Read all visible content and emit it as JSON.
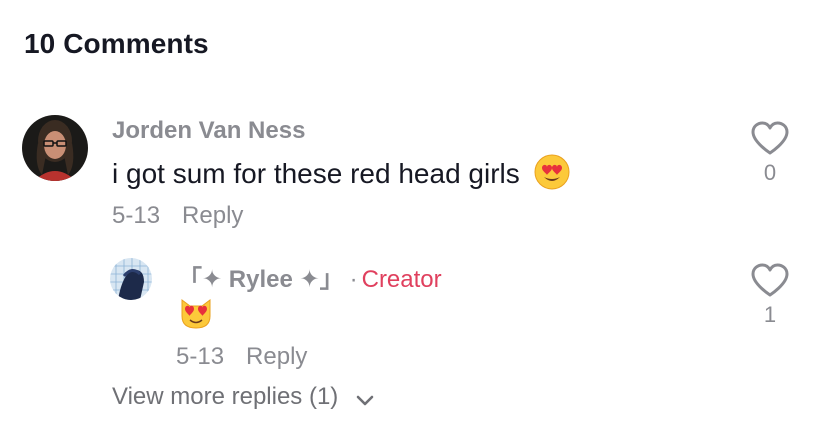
{
  "header": {
    "title": "10 Comments"
  },
  "comment": {
    "username": "Jorden Van Ness",
    "text": "i got sum for these red head girls",
    "emoji": "heart-eyes-face",
    "date": "5-13",
    "reply_label": "Reply",
    "like_count": "0"
  },
  "reply": {
    "username": "「✦ Rylee ✦」",
    "separator": "·",
    "creator_label": "Creator",
    "emoji": "heart-eyes-cat",
    "date": "5-13",
    "reply_label": "Reply",
    "like_count": "1"
  },
  "view_more": {
    "label": "View more replies (1)"
  },
  "colors": {
    "text_primary": "#161823",
    "text_secondary": "#8a8b91",
    "creator_accent": "#e0405e"
  }
}
